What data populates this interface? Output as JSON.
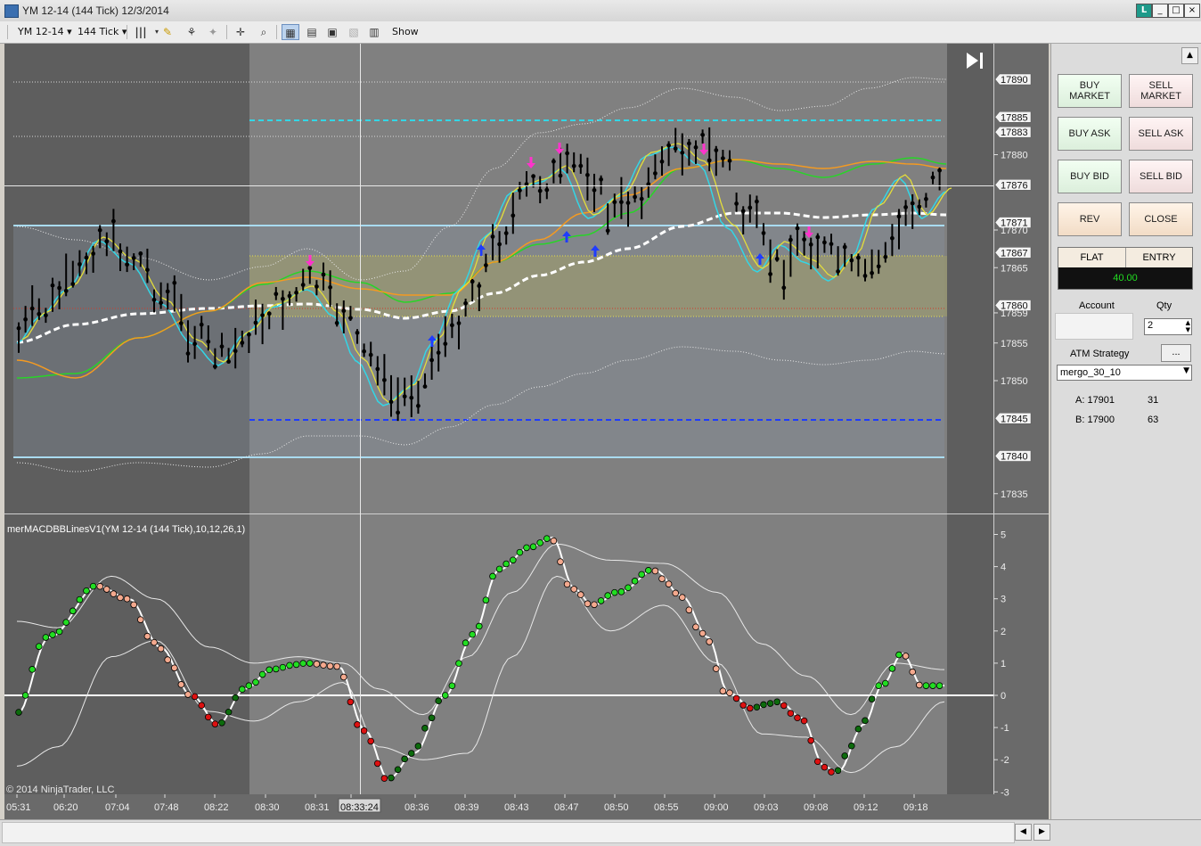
{
  "window": {
    "title": "YM 12-14 (144 Tick)  12/3/2014",
    "buttons": [
      "L",
      "_",
      "□",
      "×"
    ]
  },
  "toolbar": {
    "instrument": "YM 12-14",
    "interval": "144 Tick",
    "show_label": "Show"
  },
  "price_axis": {
    "ticks": [
      "17890",
      "17885",
      "17883",
      "17880",
      "17876",
      "17871",
      "17870",
      "17867",
      "17865",
      "17860",
      "17859",
      "17855",
      "17850",
      "17845",
      "17840",
      "17835"
    ],
    "highlighted": [
      "17890",
      "17885",
      "17883",
      "17876",
      "17871",
      "17867",
      "17860",
      "17845",
      "17840"
    ]
  },
  "indicator": {
    "label": "merMACDBBLinesV1(YM 12-14 (144 Tick),10,12,26,1)",
    "ticks": [
      "5",
      "4",
      "3",
      "2",
      "1",
      "0",
      "-1",
      "-2",
      "-3"
    ]
  },
  "time_axis": {
    "labels": [
      "05:31",
      "06:20",
      "07:04",
      "07:48",
      "08:22",
      "08:30",
      "08:31",
      "08:33:24",
      "08:36",
      "08:39",
      "08:43",
      "08:47",
      "08:50",
      "08:55",
      "09:00",
      "09:03",
      "09:08",
      "09:12",
      "09:18"
    ],
    "crosshair_label": "08:33:24"
  },
  "copyright": "© 2014 NinjaTrader, LLC",
  "order_panel": {
    "buy_market": "BUY MARKET",
    "sell_market": "SELL MARKET",
    "buy_ask": "BUY ASK",
    "sell_ask": "SELL ASK",
    "buy_bid": "BUY BID",
    "sell_bid": "SELL BID",
    "rev": "REV",
    "close": "CLOSE",
    "position_label": "FLAT",
    "entry_label": "ENTRY",
    "entry_value": "40.00",
    "account_label": "Account",
    "account_value": "",
    "qty_label": "Qty",
    "qty_value": "2",
    "atm_label": "ATM Strategy",
    "atm_more": "...",
    "atm_value": "mergo_30_10",
    "ask_label": "A: 17901",
    "ask_size": "31",
    "bid_label": "B: 17900",
    "bid_size": "63"
  },
  "colors": {
    "chart_bg": "#808080",
    "shaded_bg": "#5e5e5e",
    "axis_bg": "#6a6a6a",
    "cyan": "#33d6e6",
    "blue_line": "#1f3cff",
    "light_blue": "#a9dbf0",
    "up_arrow": "#1f3cff",
    "down_arrow": "#ff33cc",
    "green_dot": "#22dd22",
    "dark_green_dot": "#0c6b0c",
    "red_dot": "#dd1111",
    "salmon_dot": "#f4a98e",
    "entry_bg": "#111111",
    "entry_fg": "#22dd22"
  }
}
